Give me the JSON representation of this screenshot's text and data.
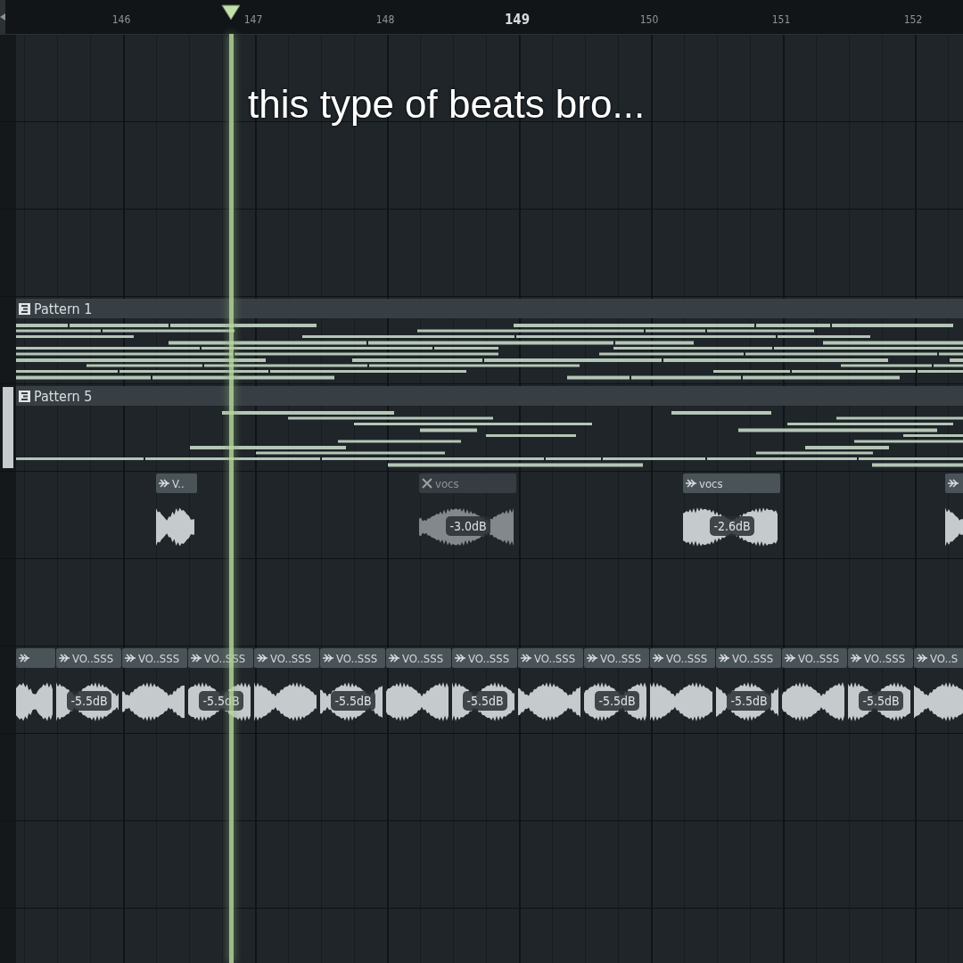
{
  "ruler": {
    "bars": [
      {
        "label": "146",
        "highlighted": false
      },
      {
        "label": "147",
        "highlighted": false
      },
      {
        "label": "148",
        "highlighted": false
      },
      {
        "label": "149",
        "highlighted": true
      },
      {
        "label": "150",
        "highlighted": false
      },
      {
        "label": "151",
        "highlighted": false
      },
      {
        "label": "152",
        "highlighted": false
      }
    ]
  },
  "caption": "this type of beats bro...",
  "tracks": [
    {
      "kind": "empty",
      "selected": false
    },
    {
      "kind": "empty",
      "selected": false
    },
    {
      "kind": "empty",
      "selected": false
    },
    {
      "kind": "pattern",
      "selected": false,
      "label": "Pattern 1"
    },
    {
      "kind": "pattern",
      "selected": true,
      "label": "Pattern 5"
    },
    {
      "kind": "audio",
      "selected": false,
      "clips": [
        {
          "label": "V..",
          "muted": false
        },
        {
          "label": "vocs",
          "muted": true,
          "volume": "-3.0dB"
        },
        {
          "label": "vocs",
          "muted": false,
          "volume": "-2.6dB"
        },
        {
          "muted": false
        }
      ]
    },
    {
      "kind": "empty",
      "selected": false
    },
    {
      "kind": "audio",
      "selected": false,
      "clips": [
        {
          "muted": false
        },
        {
          "label": "VO..SSS",
          "muted": false,
          "volume": "-5.5dB"
        },
        {
          "label": "VO..SSS",
          "muted": false
        },
        {
          "label": "VO..SSS",
          "muted": false,
          "volume": "-5.5dB"
        },
        {
          "label": "VO..SSS",
          "muted": false
        },
        {
          "label": "VO..SSS",
          "muted": false,
          "volume": "-5.5dB"
        },
        {
          "label": "VO..SSS",
          "muted": false
        },
        {
          "label": "VO..SSS",
          "muted": false,
          "volume": "-5.5dB"
        },
        {
          "label": "VO..SSS",
          "muted": false
        },
        {
          "label": "VO..SSS",
          "muted": false,
          "volume": "-5.5dB"
        },
        {
          "label": "VO..SSS",
          "muted": false
        },
        {
          "label": "VO..SSS",
          "muted": false,
          "volume": "-5.5dB"
        },
        {
          "label": "VO..SSS",
          "muted": false
        },
        {
          "label": "VO..SSS",
          "muted": false,
          "volume": "-5.5dB"
        },
        {
          "label": "VO..S",
          "muted": false
        }
      ]
    },
    {
      "kind": "empty",
      "selected": false
    },
    {
      "kind": "empty",
      "selected": false
    },
    {
      "kind": "empty",
      "selected": false
    }
  ]
}
